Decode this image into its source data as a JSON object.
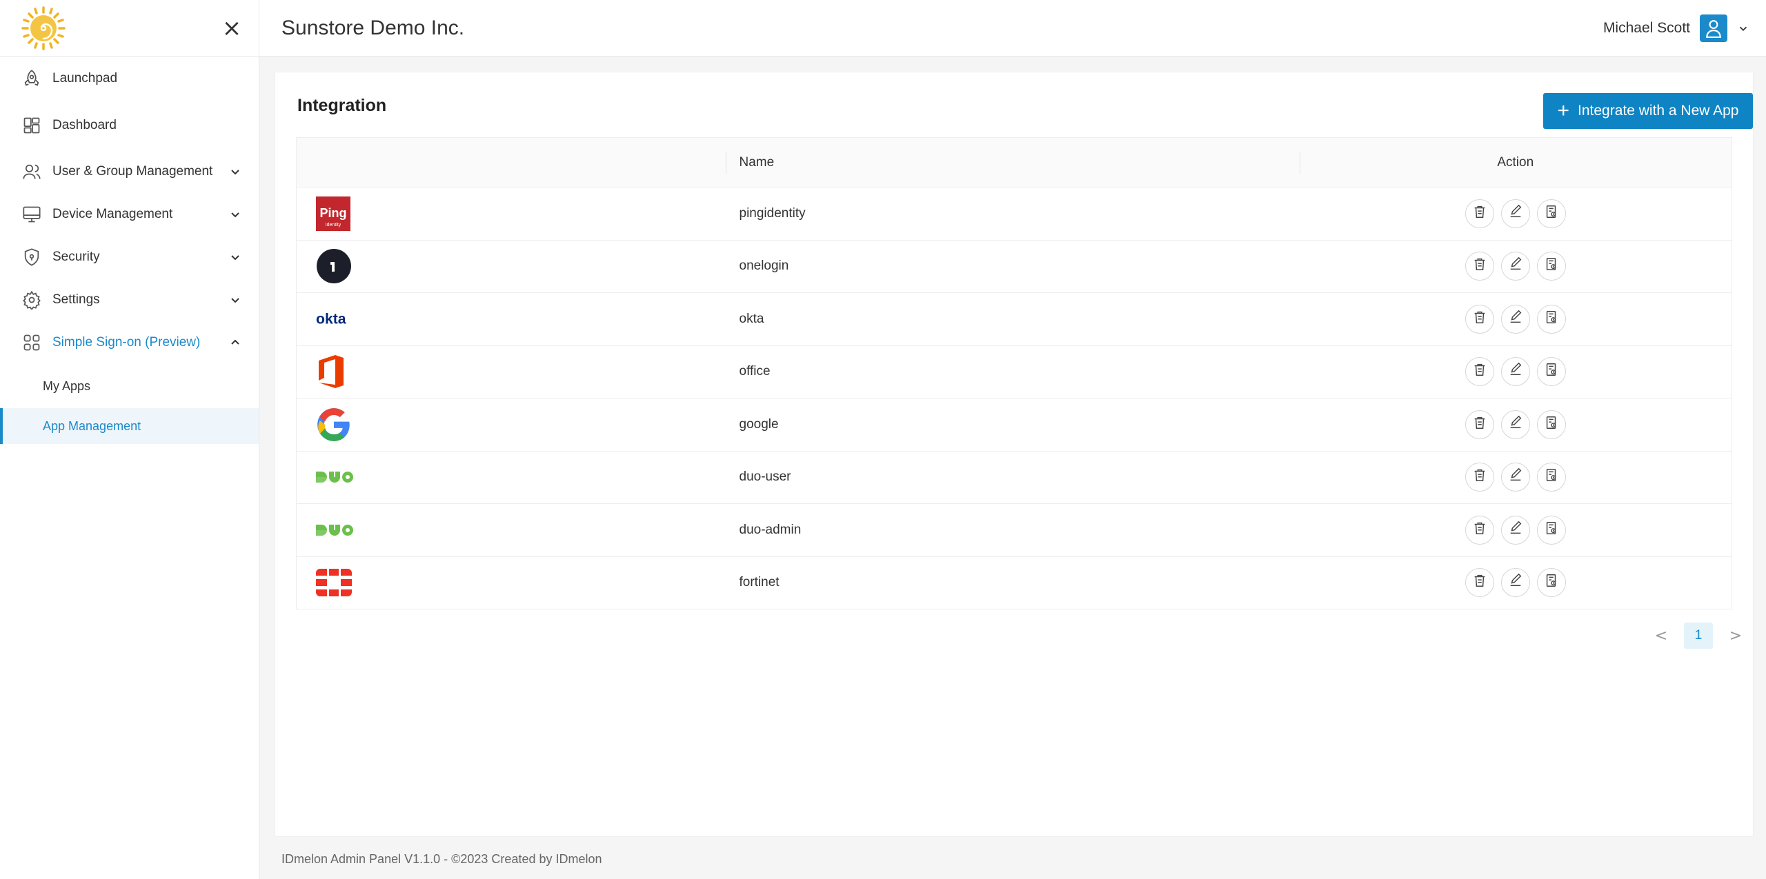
{
  "sidebar": {
    "items": [
      {
        "label": "Launchpad",
        "icon": "rocket-icon"
      },
      {
        "label": "Dashboard",
        "icon": "dashboard-icon"
      },
      {
        "label": "User & Group Management",
        "icon": "users-icon"
      },
      {
        "label": "Device Management",
        "icon": "monitor-icon"
      },
      {
        "label": "Security",
        "icon": "shield-icon"
      },
      {
        "label": "Settings",
        "icon": "gear-icon"
      },
      {
        "label": "Simple Sign-on (Preview)",
        "icon": "apps-grid-icon"
      }
    ],
    "sub_items": [
      {
        "label": "My Apps"
      },
      {
        "label": "App Management"
      }
    ],
    "close_glyph": "×"
  },
  "header": {
    "company": "Sunstore Demo Inc.",
    "user_name": "Michael Scott"
  },
  "main": {
    "title": "Integration",
    "add_button_label": "Integrate with a New App",
    "add_button_glyph": "+",
    "columns": {
      "name": "Name",
      "action": "Action"
    },
    "rows": [
      {
        "name": "pingidentity",
        "logo": "ping-logo"
      },
      {
        "name": "onelogin",
        "logo": "onelogin-logo"
      },
      {
        "name": "okta",
        "logo": "okta-logo",
        "logo_text": "okta"
      },
      {
        "name": "office",
        "logo": "office-logo"
      },
      {
        "name": "google",
        "logo": "google-logo"
      },
      {
        "name": "duo-user",
        "logo": "duo-logo"
      },
      {
        "name": "duo-admin",
        "logo": "duo-logo"
      },
      {
        "name": "fortinet",
        "logo": "fortinet-logo"
      }
    ],
    "pagination": {
      "current": "1",
      "prev": "<",
      "next": ">"
    }
  },
  "footer": {
    "text": "IDmelon Admin Panel V1.1.0 - ©2023 Created by IDmelon"
  },
  "colors": {
    "accent": "#1a8acb",
    "button": "#0f84c4"
  }
}
